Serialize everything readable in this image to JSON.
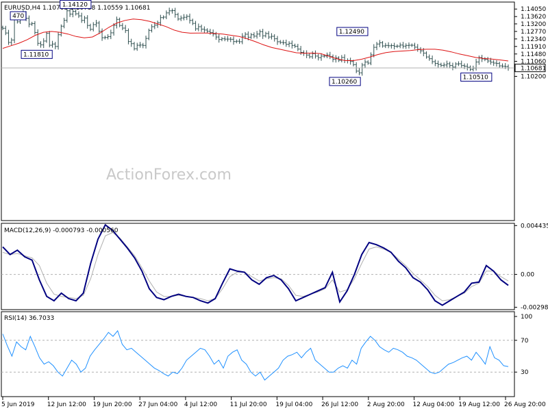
{
  "watermark": "ActionForex.com",
  "chart_data": [
    {
      "type": "line",
      "title": "EURUSD,H4  1.10705 1.10738 1.10559 1.10681",
      "ylim": [
        1.0195,
        1.1445
      ],
      "y_ticks": [
        1.1405,
        1.1362,
        1.132,
        1.1277,
        1.1234,
        1.1191,
        1.1148,
        1.1106,
        1.102
      ],
      "current_price": "1.10681",
      "series": [
        {
          "kind": "price-bars",
          "color": "#2f4f4f",
          "values": [
            1.1295,
            1.1268,
            1.1214,
            1.1228,
            1.1352,
            1.1332,
            1.1368,
            1.1381,
            1.1352,
            1.1319,
            1.1322,
            1.1271,
            1.1209,
            1.12,
            1.1222,
            1.1266,
            1.1198,
            1.1205,
            1.1191,
            1.1258,
            1.1307,
            1.1341,
            1.1395,
            1.1376,
            1.1392,
            1.1378,
            1.1366,
            1.134,
            1.1354,
            1.1311,
            1.1289,
            1.1316,
            1.1325,
            1.1278,
            1.1241,
            1.1243,
            1.1247,
            1.1269,
            1.1312,
            1.1346,
            1.1311,
            1.1296,
            1.1282,
            1.1219,
            1.1207,
            1.1178,
            1.1198,
            1.1199,
            1.1197,
            1.1237,
            1.1283,
            1.1304,
            1.1313,
            1.1327,
            1.1356,
            1.1359,
            1.1383,
            1.1395,
            1.1396,
            1.1374,
            1.1348,
            1.1354,
            1.1358,
            1.1363,
            1.134,
            1.1323,
            1.1292,
            1.1304,
            1.129,
            1.1285,
            1.1278,
            1.127,
            1.1262,
            1.1245,
            1.1231,
            1.1235,
            1.1233,
            1.1233,
            1.1232,
            1.1219,
            1.1221,
            1.1218,
            1.1249,
            1.1261,
            1.1244,
            1.1258,
            1.125,
            1.1262,
            1.1276,
            1.1252,
            1.1265,
            1.1245,
            1.1249,
            1.1235,
            1.1218,
            1.1214,
            1.1212,
            1.1203,
            1.1209,
            1.1197,
            1.1192,
            1.1176,
            1.1157,
            1.1153,
            1.1142,
            1.1132,
            1.115,
            1.1136,
            1.1127,
            1.1136,
            1.1136,
            1.1142,
            1.1133,
            1.1117,
            1.1125,
            1.1112,
            1.1128,
            1.111,
            1.1111,
            1.1105,
            1.1087,
            1.105,
            1.104,
            1.1085,
            1.1102,
            1.1096,
            1.1143,
            1.1186,
            1.1205,
            1.1212,
            1.1194,
            1.1197,
            1.1195,
            1.1196,
            1.1192,
            1.1193,
            1.1199,
            1.1193,
            1.1197,
            1.1198,
            1.1198,
            1.1187,
            1.1175,
            1.1166,
            1.1153,
            1.1131,
            1.1121,
            1.1104,
            1.1094,
            1.1088,
            1.1083,
            1.1085,
            1.1092,
            1.1082,
            1.1073,
            1.1091,
            1.1092,
            1.1082,
            1.1078,
            1.1072,
            1.106,
            1.1067,
            1.1102,
            1.1127,
            1.112,
            1.1117,
            1.1108,
            1.1101,
            1.1096,
            1.1094,
            1.108,
            1.1078,
            1.1076,
            1.1068
          ]
        },
        {
          "kind": "moving-average",
          "color": "#dd1111",
          "values": [
            1.118,
            1.1195,
            1.121,
            1.123,
            1.1255,
            1.1272,
            1.1277,
            1.1272,
            1.1262,
            1.1248,
            1.124,
            1.1245,
            1.127,
            1.13,
            1.1325,
            1.134,
            1.1348,
            1.1344,
            1.1335,
            1.132,
            1.1305,
            1.1285,
            1.1272,
            1.1267,
            1.1268,
            1.1268,
            1.1266,
            1.1262,
            1.1255,
            1.1248,
            1.1235,
            1.1218,
            1.12,
            1.1185,
            1.1175,
            1.1165,
            1.1155,
            1.1152,
            1.1153,
            1.115,
            1.1135,
            1.112,
            1.111,
            1.111,
            1.1118,
            1.113,
            1.1145,
            1.1156,
            1.1162,
            1.1165,
            1.1168,
            1.1173,
            1.1175,
            1.1175,
            1.117,
            1.116,
            1.1148,
            1.1138,
            1.1128,
            1.1122,
            1.1119,
            1.1114,
            1.1108
          ]
        }
      ],
      "annotations": [
        "1.14120",
        "1.12490",
        "1.11810",
        "1.10260",
        "1.10510",
        "470"
      ]
    },
    {
      "type": "line",
      "title": "MACD(12,26,9) -0.000793 -0.000560",
      "ylim": [
        -0.0032,
        0.00464
      ],
      "y_ticks": [
        0.004435,
        0.0,
        -0.002988
      ],
      "series": [
        {
          "kind": "macd-line",
          "color": "#000080",
          "values": [
            0.0025,
            0.0018,
            0.0022,
            0.0016,
            0.0013,
            -0.0005,
            -0.002,
            -0.0024,
            -0.0017,
            -0.0022,
            -0.0024,
            -0.0017,
            0.001,
            0.0032,
            0.0045,
            0.004,
            0.0032,
            0.0024,
            0.0015,
            0.0003,
            -0.0013,
            -0.0021,
            -0.0023,
            -0.002,
            -0.0018,
            -0.002,
            -0.0021,
            -0.0024,
            -0.0026,
            -0.0022,
            -0.0008,
            0.0005,
            0.0003,
            0.0002,
            -0.0005,
            -0.0009,
            -0.0003,
            -0.0001,
            -0.0005,
            -0.0013,
            -0.0024,
            -0.0021,
            -0.0018,
            -0.0015,
            -0.0012,
            0.0002,
            -0.0025,
            -0.0015,
            0.0,
            0.0018,
            0.0029,
            0.0027,
            0.0024,
            0.002,
            0.0012,
            0.0006,
            -0.0003,
            -0.0007,
            -0.0014,
            -0.0024,
            -0.0028,
            -0.0024,
            -0.002,
            -0.0016,
            -0.0008,
            -0.0007,
            0.0008,
            0.0003,
            -0.0005,
            -0.001
          ]
        },
        {
          "kind": "signal-line",
          "color": "#b0b0b0",
          "values": [
            0.002,
            0.0018,
            0.0019,
            0.0017,
            0.0015,
            0.0008,
            -0.0008,
            -0.0018,
            -0.002,
            -0.0021,
            -0.0022,
            -0.0019,
            -0.0004,
            0.0018,
            0.0035,
            0.0038,
            0.0033,
            0.0025,
            0.0017,
            0.0006,
            -0.0006,
            -0.0016,
            -0.002,
            -0.002,
            -0.0019,
            -0.002,
            -0.0021,
            -0.0022,
            -0.0024,
            -0.0022,
            -0.0013,
            -0.0002,
            0.0002,
            0.0002,
            -0.0002,
            -0.0006,
            -0.0004,
            -0.0003,
            -0.0004,
            -0.001,
            -0.0019,
            -0.002,
            -0.0018,
            -0.0016,
            -0.0013,
            -0.0005,
            -0.0016,
            -0.0014,
            -0.0004,
            0.001,
            0.0023,
            0.0025,
            0.0023,
            0.002,
            0.0014,
            0.0008,
            0.0001,
            -0.0005,
            -0.0011,
            -0.0019,
            -0.0024,
            -0.0023,
            -0.002,
            -0.0017,
            -0.0011,
            -0.0008,
            0.0003,
            0.0003,
            -0.0002,
            -0.0006
          ]
        }
      ]
    },
    {
      "type": "line",
      "title": "RSI(14) 36.7033",
      "ylim": [
        0,
        100
      ],
      "y_ticks": [
        100,
        70,
        30
      ],
      "series": [
        {
          "kind": "rsi",
          "color": "#1e90ff",
          "values": [
            78,
            63,
            50,
            68,
            62,
            58,
            75,
            62,
            48,
            40,
            43,
            38,
            30,
            25,
            35,
            45,
            40,
            30,
            35,
            50,
            58,
            65,
            72,
            80,
            75,
            82,
            65,
            58,
            60,
            55,
            50,
            45,
            40,
            35,
            32,
            28,
            25,
            30,
            28,
            35,
            45,
            50,
            55,
            60,
            58,
            50,
            40,
            45,
            35,
            50,
            55,
            58,
            45,
            40,
            30,
            25,
            30,
            20,
            25,
            30,
            35,
            45,
            50,
            52,
            55,
            48,
            55,
            60,
            45,
            40,
            35,
            30,
            30,
            35,
            38,
            35,
            45,
            40,
            60,
            68,
            75,
            70,
            62,
            58,
            55,
            60,
            58,
            55,
            50,
            48,
            45,
            40,
            35,
            30,
            28,
            30,
            35,
            40,
            42,
            45,
            48,
            50,
            45,
            55,
            48,
            40,
            62,
            48,
            45,
            38,
            37
          ]
        }
      ]
    }
  ],
  "x_axis": {
    "tick_labels": [
      "5 Jun 2019",
      "12 Jun 12:00",
      "19 Jun 20:00",
      "27 Jun 04:00",
      "4 Jul 12:00",
      "11 Jul 20:00",
      "19 Jul 04:00",
      "26 Jul 12:00",
      "2 Aug 20:00",
      "12 Aug 04:00",
      "19 Aug 12:00",
      "26 Aug 20:00"
    ]
  }
}
